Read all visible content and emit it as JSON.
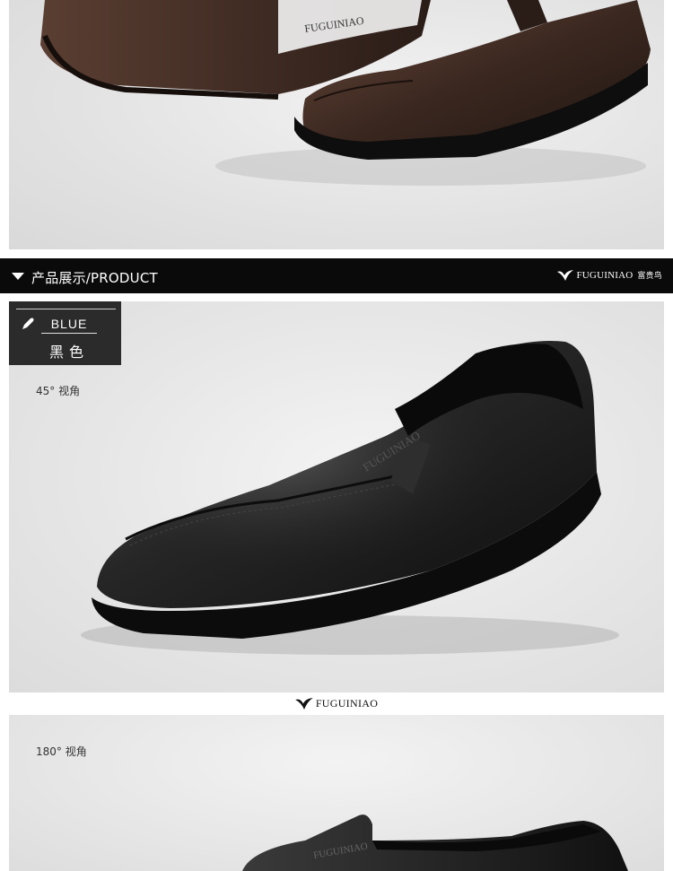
{
  "header_bar": {
    "title": "产品展示/PRODUCT",
    "brand_text": "FUGUINIAO",
    "brand_cn": "富贵鸟"
  },
  "color_tag": {
    "en": "BLUE",
    "cn": "黑色"
  },
  "views": {
    "angle_45": "45° 视角",
    "angle_180": "180° 视角"
  },
  "product_stamp": "FUGUINIAO",
  "footer_brand": {
    "text": "FUGUINIAO"
  },
  "colors": {
    "bar_bg": "#0a0a0a",
    "tag_bg": "#2b2b2b",
    "shoe_brown": "#3d2a22",
    "shoe_black": "#1a1a1a"
  },
  "icons": [
    "triangle-down-icon",
    "bird-logo-icon",
    "pen-icon"
  ]
}
